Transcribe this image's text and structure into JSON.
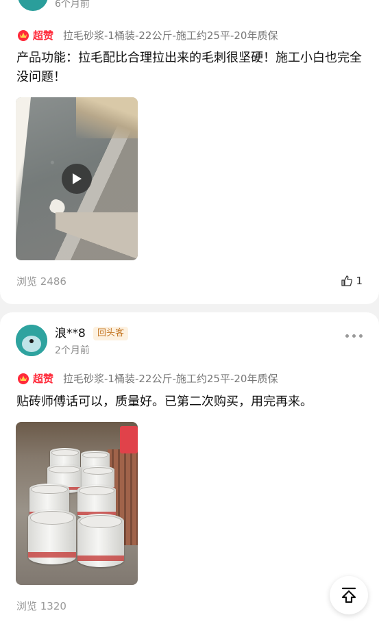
{
  "review1": {
    "timestamp_partial": "6个月前",
    "rating_label": "超赞",
    "sku": "拉毛砂浆-1桶装-22公斤-施工约25平-20年质保",
    "text": "产品功能：拉毛配比合理拉出来的毛刺很坚硬！施工小白也完全没问题！",
    "media": "video",
    "views": "浏览 2486",
    "likes": "1"
  },
  "review2": {
    "username": "浪**8",
    "badge": "回头客",
    "time": "2个月前",
    "rating_label": "超赞",
    "sku": "拉毛砂浆-1桶装-22公斤-施工约25平-20年质保",
    "text": "贴砖师傅话可以，质量好。已第二次购买，用完再来。",
    "views": "浏览 1320"
  },
  "icons": {
    "rating": "crown-badge-icon",
    "play": "play-icon",
    "like": "thumbs-up-icon",
    "more": "more-dots-icon",
    "back_to_top": "arrow-up-to-top-icon"
  },
  "colors": {
    "accent_red": "#ff2a3a",
    "badge_text": "#c57a2a",
    "badge_bg": "#fdf1e0",
    "avatar_teal": "#2ea39f"
  }
}
